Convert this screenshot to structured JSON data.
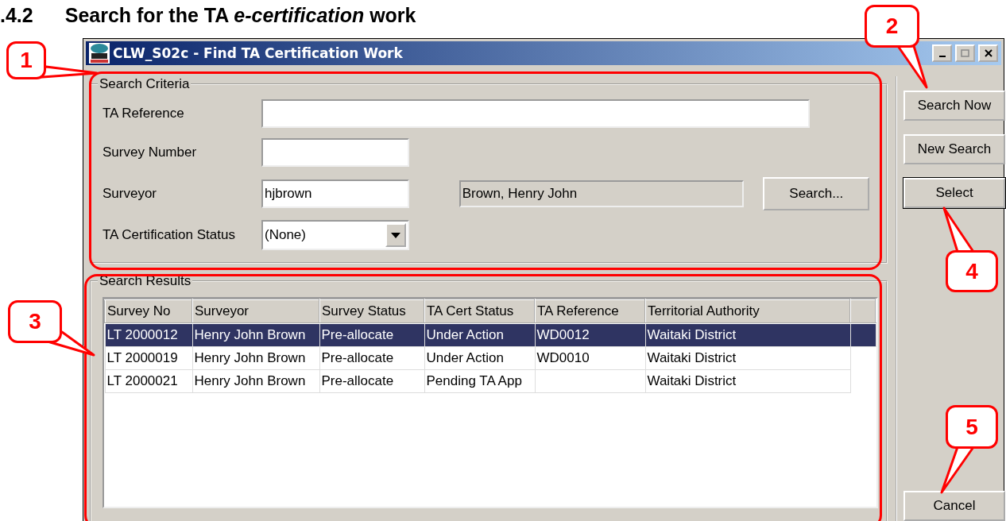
{
  "heading": {
    "number": ".4.2",
    "text": "Search for the TA *e-certification* work"
  },
  "window": {
    "title": "CLW_S02c - Find TA Certification Work",
    "controls": [
      {
        "kind": "minimize"
      },
      {
        "kind": "maximize"
      },
      {
        "kind": "close"
      }
    ]
  },
  "search_criteria": {
    "legend": "Search Criteria",
    "fields": [
      {
        "kind": "text",
        "label": "TA Reference"
      },
      {
        "kind": "text",
        "label": "Survey Number"
      },
      {
        "kind": "lookup",
        "label": "Surveyor",
        "value": "hjbrown",
        "display": "Brown, Henry John",
        "button": {
          "label": "Search..."
        }
      },
      {
        "kind": "dropdown",
        "label": "TA Certification Status",
        "value": "(None)"
      }
    ]
  },
  "search_results": {
    "legend": "Search Results",
    "columns": [
      "Survey No",
      "Surveyor",
      "Survey Status",
      "TA Cert Status",
      "TA Reference",
      "Territorial Authority"
    ],
    "rows": [
      {
        "selected": true,
        "cells": [
          "LT 2000012",
          "Henry John Brown",
          "Pre-allocate",
          "Under Action",
          "WD0012",
          "Waitaki District"
        ]
      },
      {
        "selected": false,
        "cells": [
          "LT 2000019",
          "Henry John Brown",
          "Pre-allocate",
          "Under Action",
          "WD0010",
          "Waitaki District"
        ]
      },
      {
        "selected": false,
        "cells": [
          "LT 2000021",
          "Henry John Brown",
          "Pre-allocate",
          "Pending TA App",
          "",
          "Waitaki District"
        ]
      }
    ]
  },
  "buttons": [
    {
      "label": "Search Now",
      "default": false
    },
    {
      "label": "New Search",
      "default": false
    },
    {
      "label": "Select",
      "default": true
    },
    {
      "label": "Cancel",
      "default": false
    }
  ],
  "callouts": [
    {
      "label": "1"
    },
    {
      "label": "2"
    },
    {
      "label": "3"
    },
    {
      "label": "4"
    },
    {
      "label": "5"
    }
  ]
}
